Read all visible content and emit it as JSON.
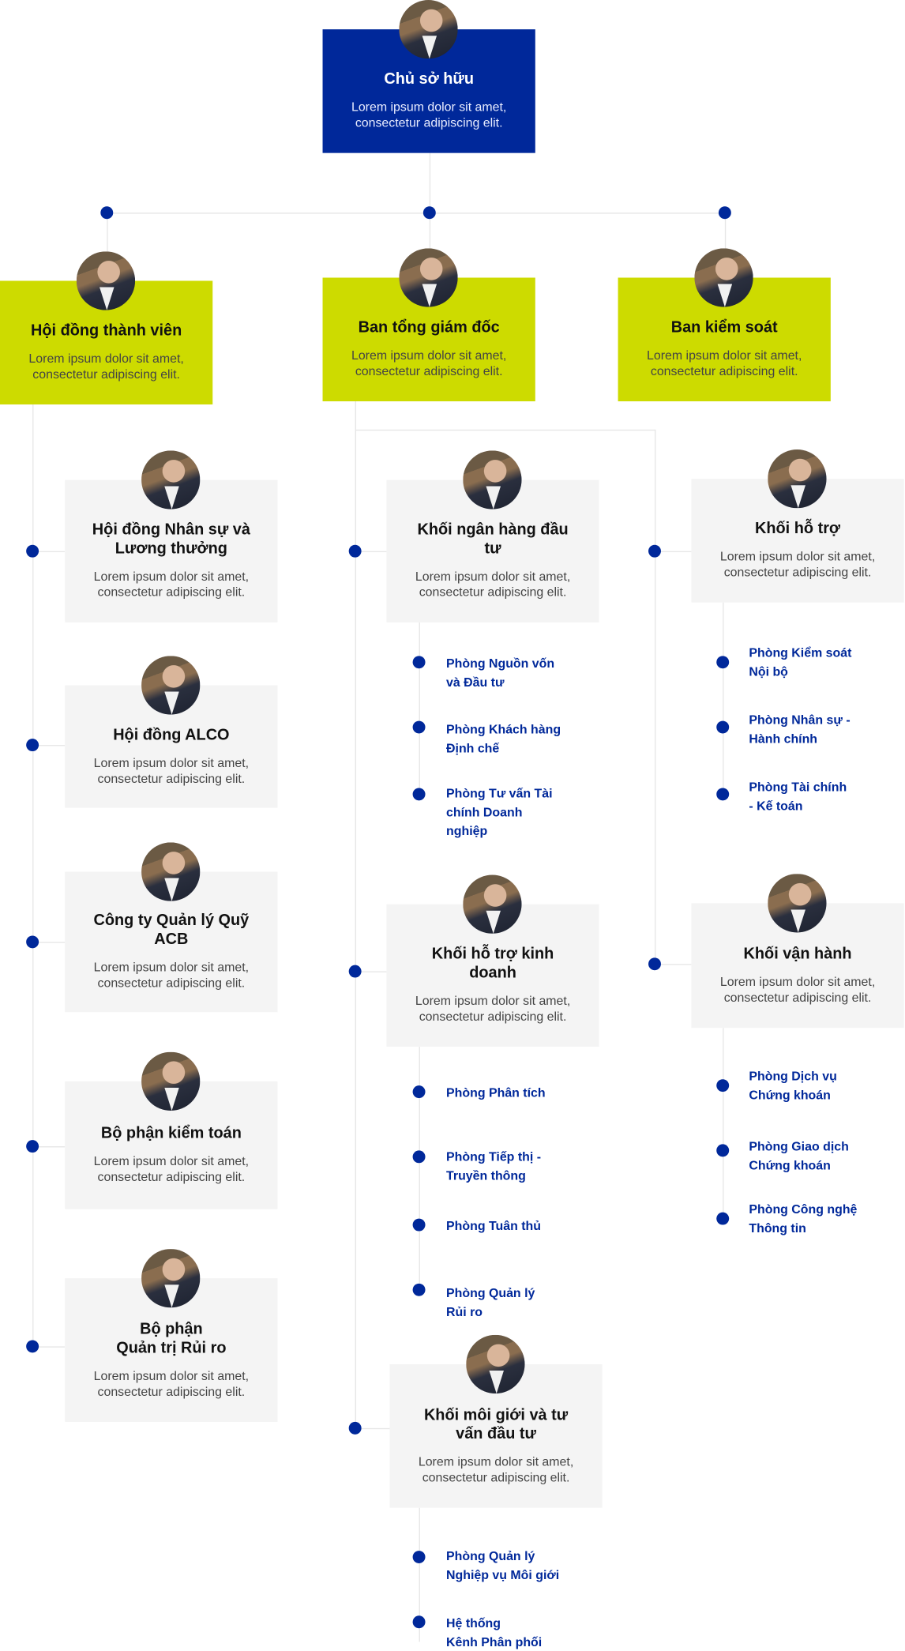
{
  "lorem": "Lorem ipsum dolor sit amet, consectetur adipiscing elit.",
  "root": {
    "title": "Chủ sở hữu"
  },
  "level2": [
    {
      "title": "Hội đồng thành viên"
    },
    {
      "title": "Ban tổng giám đốc"
    },
    {
      "title": "Ban kiểm soát"
    }
  ],
  "left_cards": [
    {
      "title": "Hội đồng Nhân sự và\nLương thưởng"
    },
    {
      "title": "Hội đồng ALCO"
    },
    {
      "title": "Công ty Quản lý Quỹ\nACB"
    },
    {
      "title": "Bộ phận kiểm toán"
    },
    {
      "title": "Bộ phận\nQuản trị Rủi ro"
    }
  ],
  "middle_cards": [
    {
      "title": "Khối  ngân hàng đầu\ntư",
      "subs": [
        "Phòng Nguồn vốn\nvà Đầu tư",
        "Phòng Khách hàng\nĐịnh chế",
        "Phòng Tư vấn Tài\nchính Doanh\nnghiệp"
      ]
    },
    {
      "title": "Khối hỗ trợ kinh\ndoanh",
      "subs": [
        "Phòng Phân tích",
        "Phòng Tiếp thị -\nTruyền thông",
        "Phòng Tuân thủ",
        "Phòng Quản lý\nRủi ro"
      ]
    },
    {
      "title": "Khối môi giới và tư\nvấn đầu tư",
      "subs": [
        "Phòng Quản lý\nNghiệp vụ Môi giới",
        "Hệ thống\nKênh Phân phối"
      ]
    }
  ],
  "right_cards": [
    {
      "title": "Khối hỗ trợ",
      "subs": [
        "Phòng Kiểm soát\nNội bộ",
        "Phòng Nhân sự -\nHành chính",
        "Phòng Tài chính\n- Kế toán"
      ]
    },
    {
      "title": "Khối vận hành",
      "subs": [
        "Phòng Dịch vụ\nChứng khoán",
        "Phòng Giao dịch\nChứng khoán",
        "Phòng Công nghệ\nThông tin"
      ]
    }
  ],
  "colors": {
    "primary": "#00289a",
    "accent": "#cddb00",
    "card": "#f4f4f4"
  }
}
